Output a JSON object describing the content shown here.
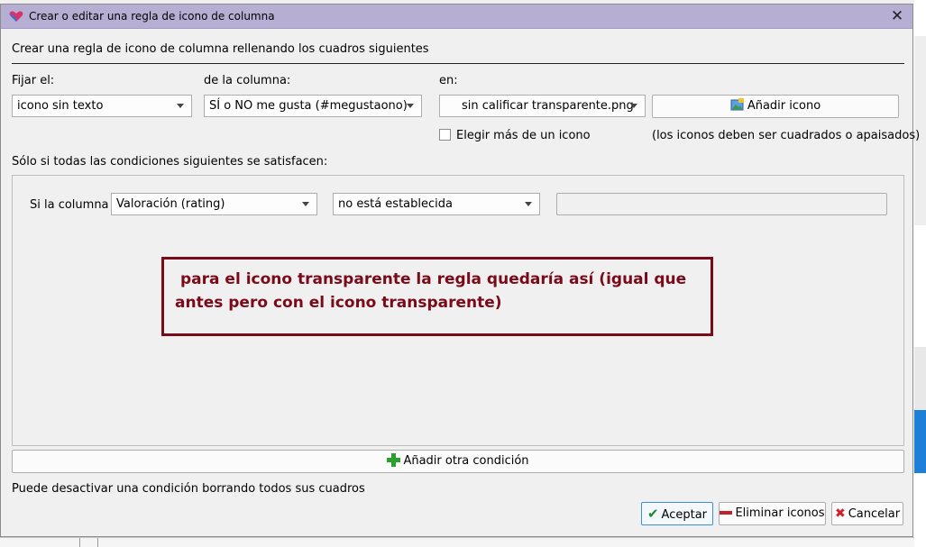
{
  "window": {
    "title": "Crear o editar una regla de icono de columna",
    "close_glyph": "✕",
    "app_icon": "calibre-heart-icon"
  },
  "header": {
    "instruction": "Crear una regla de icono de columna rellenando los cuadros siguientes"
  },
  "rule": {
    "set_label": "Fijar el:",
    "set_value": "icono sin texto",
    "column_label": "de la columna:",
    "column_value": "SÍ o NO me gusta (#megustaono)",
    "in_label": "en:",
    "icon_value": "sin calificar transparente.png",
    "add_icon_label": "Añadir icono",
    "multi_icon_label": "Elegir más de un icono",
    "multi_icon_checked": false,
    "icon_hint": "(los iconos deben ser cuadrados o apaisados)"
  },
  "conditions": {
    "heading": "Sólo si todas las condiciones siguientes se satisfacen:",
    "rows": [
      {
        "prefix": "Si la columna",
        "column": "Valoración (rating)",
        "operator": "no está establecida",
        "value": ""
      }
    ],
    "add_condition_label": "Añadir otra condición",
    "footer_note": "Puede desactivar una condición borrando todos sus cuadros"
  },
  "annotation": {
    "text": "para el icono transparente la regla quedaría así (igual que antes pero con el icono transparente)",
    "color": "#7b0a19"
  },
  "buttons": {
    "accept": "Aceptar",
    "remove_icons": "Eliminar iconos",
    "cancel": "Cancelar"
  },
  "colors": {
    "titlebar": "#b7afd3",
    "dialog_bg": "#f0f0f0",
    "accept_check": "#1a8a2a",
    "add_plus": "#2aa12a",
    "remove_bar": "#c0202a",
    "cancel_x": "#d0202a"
  }
}
